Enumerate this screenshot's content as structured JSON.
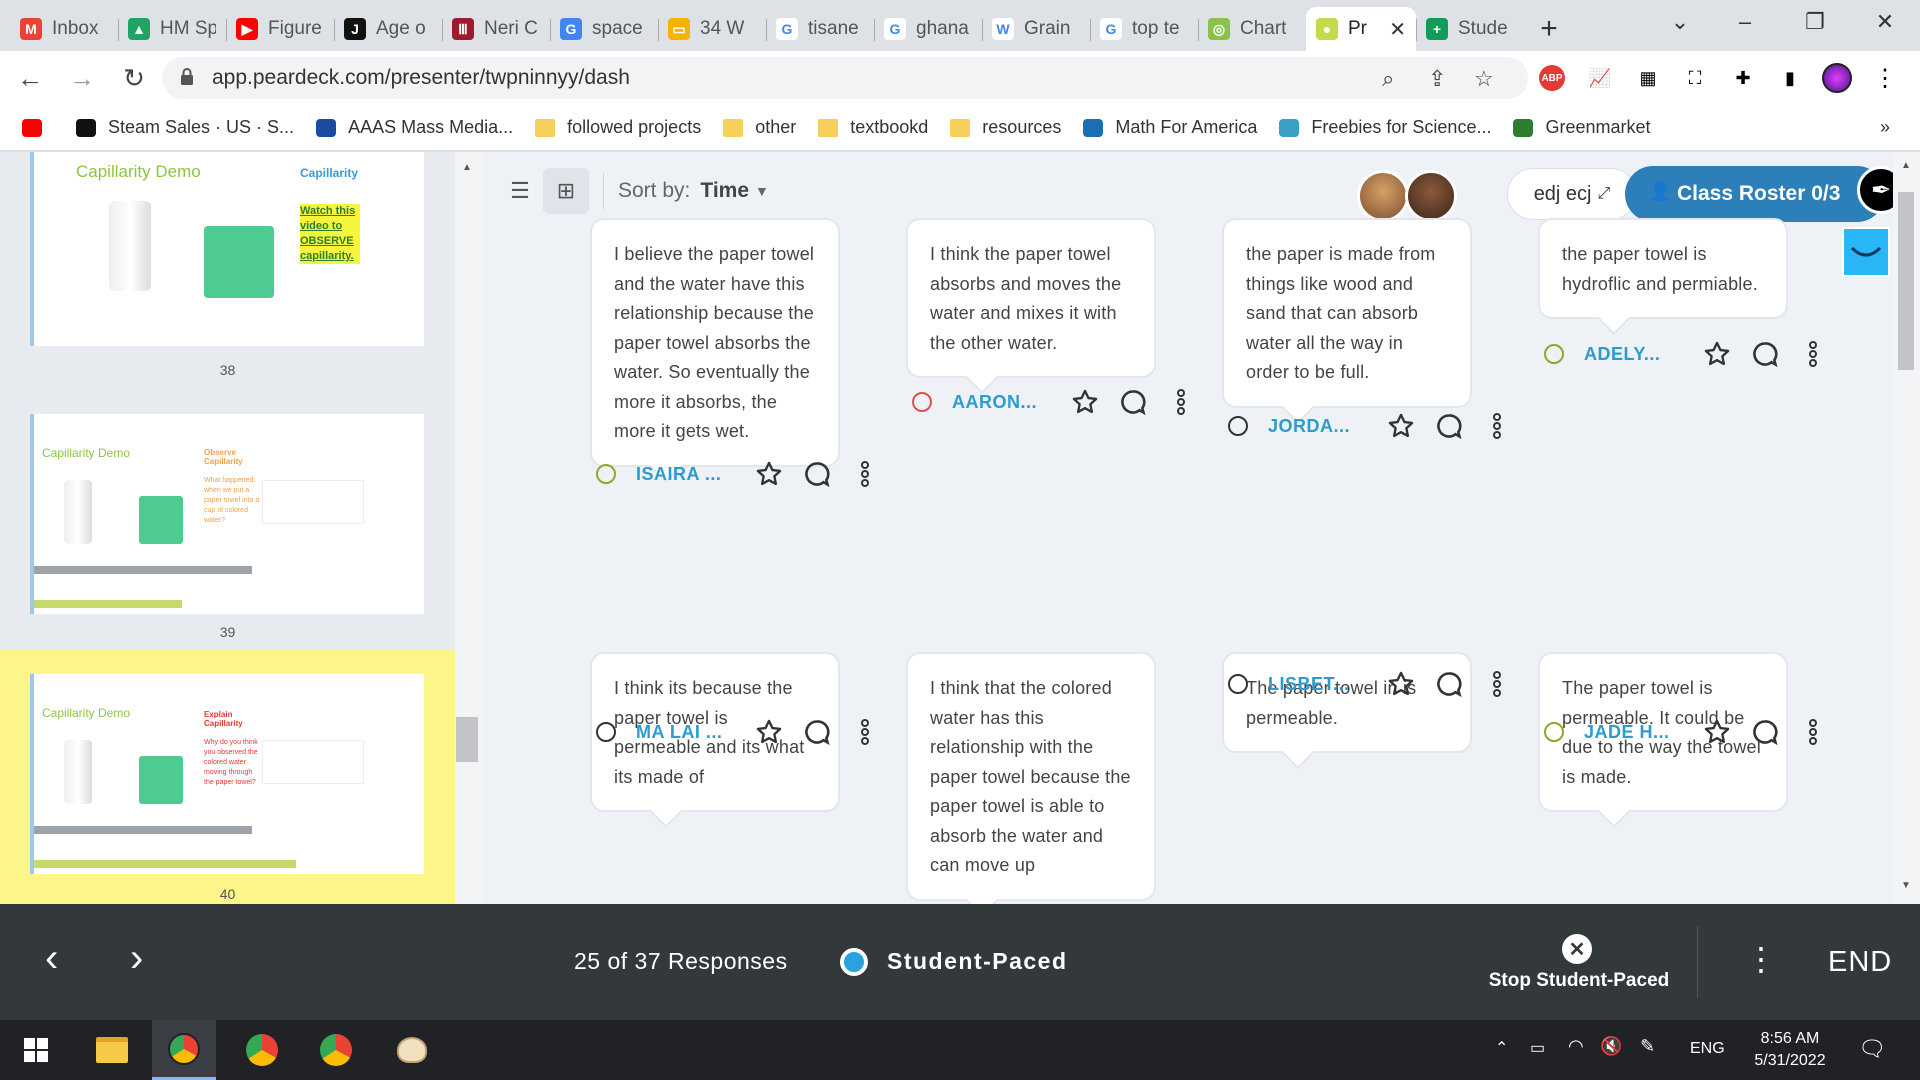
{
  "browser": {
    "tabs": [
      {
        "label": "Inbox",
        "icon": "gmail-icon",
        "color": "#ea4335",
        "glyph": "M"
      },
      {
        "label": "HM Sp",
        "icon": "drive-icon",
        "color": "#1fa463",
        "glyph": "▲"
      },
      {
        "label": "Figure",
        "icon": "youtube-icon",
        "color": "#ff0000",
        "glyph": "▶"
      },
      {
        "label": "Age o",
        "icon": "jstor-icon",
        "color": "#111111",
        "glyph": "J"
      },
      {
        "label": "Neri C",
        "icon": "bars-icon",
        "color": "#9b1c31",
        "glyph": "Ⅲ"
      },
      {
        "label": "space",
        "icon": "google-lens-icon",
        "color": "#4285f4",
        "glyph": "G"
      },
      {
        "label": "34 W",
        "icon": "slides-icon",
        "color": "#f4b400",
        "glyph": "▭"
      },
      {
        "label": "tisane",
        "icon": "google-icon",
        "color": "#ffffff",
        "glyph": "G"
      },
      {
        "label": "ghana",
        "icon": "google-icon",
        "color": "#ffffff",
        "glyph": "G"
      },
      {
        "label": "Grain",
        "icon": "wikipedia-icon",
        "color": "#ffffff",
        "glyph": "W"
      },
      {
        "label": "top te",
        "icon": "google-icon",
        "color": "#ffffff",
        "glyph": "G"
      },
      {
        "label": "Chart",
        "icon": "chart-icon",
        "color": "#8bc34a",
        "glyph": "◎"
      },
      {
        "label": "Pr",
        "icon": "peardeck-icon",
        "color": "#c5d94a",
        "glyph": "●",
        "active": true
      },
      {
        "label": "Stude",
        "icon": "sheets-plus-icon",
        "color": "#0f9d58",
        "glyph": "+"
      }
    ],
    "url": "app.peardeck.com/presenter/twpninnyy/dash",
    "bookmarks": [
      {
        "label": "",
        "icon": "youtube-icon"
      },
      {
        "label": "Steam Sales · US · S...",
        "icon": "steam-icon"
      },
      {
        "label": "AAAS Mass Media...",
        "icon": "aaas-icon"
      },
      {
        "label": "followed projects",
        "icon": "folder-icon"
      },
      {
        "label": "other",
        "icon": "folder-icon"
      },
      {
        "label": "textbookd",
        "icon": "folder-icon"
      },
      {
        "label": "resources",
        "icon": "folder-icon"
      },
      {
        "label": "Math For America",
        "icon": "mfa-icon"
      },
      {
        "label": "Freebies for Science...",
        "icon": "leaf-icon"
      },
      {
        "label": "Greenmarket",
        "icon": "greenmarket-icon"
      }
    ],
    "bookmarks_more": "»"
  },
  "sidebar": {
    "slides": [
      {
        "number": "38",
        "title": "Capillarity Demo",
        "heading": "Capillarity",
        "note": "Watch this video to OBSERVE capillarity.",
        "selected": false
      },
      {
        "number": "39",
        "title": "Capillarity Demo",
        "heading": "Observe Capillarity",
        "note": "What happened when we put a paper towel into a cup of colored water?",
        "selected": false
      },
      {
        "number": "40",
        "title": "Capillarity Demo",
        "heading": "Explain Capillarity",
        "note": "Why do you think you observed the colored water moving through the paper towel?",
        "selected": true
      }
    ]
  },
  "toolbar": {
    "sort_label": "Sort by:",
    "sort_value": "Time",
    "class_code": "edj ecj",
    "roster_label": "Class Roster 0/3"
  },
  "responses": [
    {
      "text": "I believe the paper towel and the water have this relationship because the paper towel absorbs the water. So eventually the more it absorbs, the more it gets wet.",
      "student": "ISAIRA ...",
      "mood": "green"
    },
    {
      "text": "I think the paper towel absorbs and moves the water and mixes it with the other water.",
      "student": "AARON...",
      "mood": "red"
    },
    {
      "text": "the paper is made from things like wood and sand that can absorb water all the way in order to be full.",
      "student": "JORDA...",
      "mood": "neutral"
    },
    {
      "text": "the paper towel is hydroflic and permiable.",
      "student": "ADELY...",
      "mood": "green"
    },
    {
      "text": "I think its because the paper towel is permeable and its what its made of",
      "student": "MA LAI ...",
      "mood": "neutral"
    },
    {
      "text": "I think that the colored water has this relationship with the paper towel because the paper towel is able to absorb the water and can move up",
      "student": "",
      "mood": "none"
    },
    {
      "text": "The paper towel in is permeable.",
      "student": "LISBET...",
      "mood": "neutral"
    },
    {
      "text": "The paper towel is permeable. It could be due to the way the towel is made.",
      "student": "JADE H...",
      "mood": "green"
    }
  ],
  "bottom": {
    "responses_count": "25 of 37 Responses",
    "mode": "Student-Paced",
    "stop_label": "Stop Student-Paced",
    "end_label": "END"
  },
  "taskbar": {
    "language": "ENG",
    "time": "8:56 AM",
    "date": "5/31/2022"
  },
  "colors": {
    "accent": "#2c7fb8",
    "student_name": "#2e9bcf",
    "bottom_bar": "#33393b",
    "selected_slide": "#fbf58a"
  }
}
